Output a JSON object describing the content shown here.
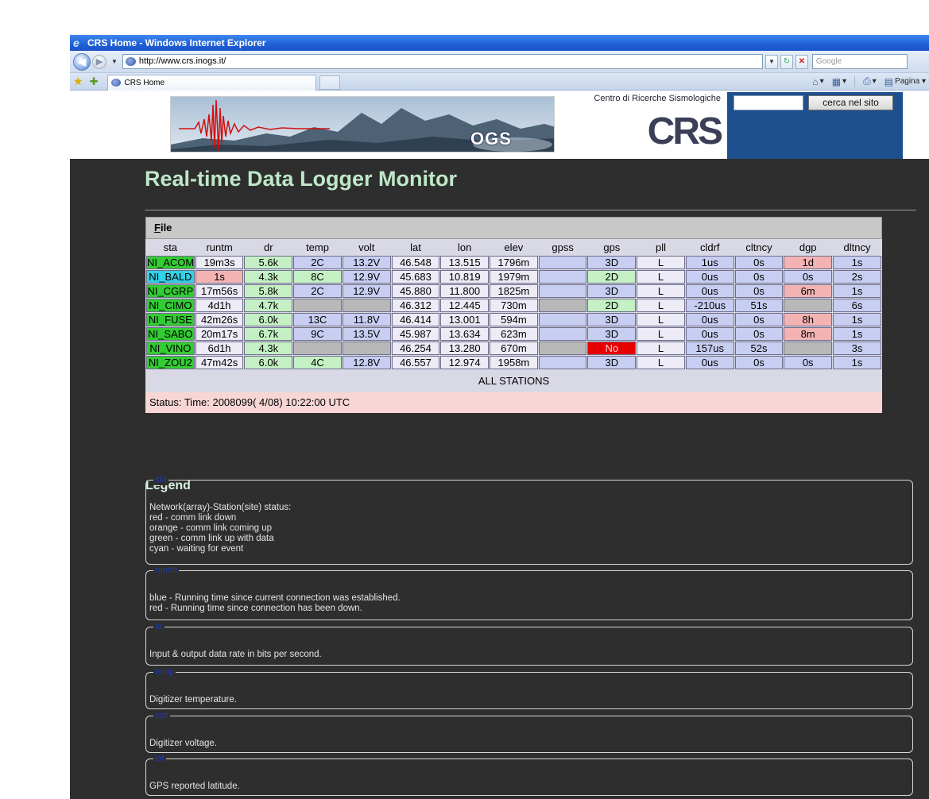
{
  "browser": {
    "title": "CRS Home - Windows Internet Explorer",
    "url": "http://www.crs.inogs.it/",
    "search_placeholder": "Google",
    "tab_label": "CRS Home",
    "page_menu_label": "Pagina"
  },
  "banner": {
    "caption": "Centro di Ricerche Sismologiche",
    "crs_logo": "CRS",
    "ogs_logo": "OGS",
    "search_button": "cerca nel sito"
  },
  "page": {
    "title": "Real-time Data Logger Monitor",
    "file_menu_rest": "ile",
    "file_menu_mnemonic": "F"
  },
  "table": {
    "headers": [
      "sta",
      "runtm",
      "dr",
      "temp",
      "volt",
      "lat",
      "lon",
      "elev",
      "gpss",
      "gps",
      "pll",
      "cldrf",
      "cltncy",
      "dgp",
      "dltncy"
    ],
    "rows": [
      [
        "NI_ACOM",
        "19m3s",
        "5.6k",
        "2C",
        "13.2V",
        "46.548",
        "13.515",
        "1796m",
        "",
        "3D",
        "L",
        "1us",
        "0s",
        "1d",
        "1s"
      ],
      [
        "NI_BALD",
        "1s",
        "4.3k",
        "8C",
        "12.9V",
        "45.683",
        "10.819",
        "1979m",
        "",
        "2D",
        "L",
        "0us",
        "0s",
        "0s",
        "2s"
      ],
      [
        "NI_CGRP",
        "17m56s",
        "5.8k",
        "2C",
        "12.9V",
        "45.880",
        "11.800",
        "1825m",
        "",
        "3D",
        "L",
        "0us",
        "0s",
        "6m",
        "1s"
      ],
      [
        "NI_CIMO",
        "4d1h",
        "4.7k",
        "",
        "",
        "46.312",
        "12.445",
        "730m",
        "",
        "2D",
        "L",
        "-210us",
        "51s",
        "",
        "6s"
      ],
      [
        "NI_FUSE",
        "42m26s",
        "6.0k",
        "13C",
        "11.8V",
        "46.414",
        "13.001",
        "594m",
        "",
        "3D",
        "L",
        "0us",
        "0s",
        "8h",
        "1s"
      ],
      [
        "NI_SABO",
        "20m17s",
        "6.7k",
        "9C",
        "13.5V",
        "45.987",
        "13.634",
        "623m",
        "",
        "3D",
        "L",
        "0us",
        "0s",
        "8m",
        "1s"
      ],
      [
        "NI_VINO",
        "6d1h",
        "4.3k",
        "",
        "",
        "46.254",
        "13.280",
        "670m",
        "",
        "No",
        "L",
        "157us",
        "52s",
        "",
        "3s"
      ],
      [
        "NI_ZOU2",
        "47m42s",
        "6.0k",
        "4C",
        "12.8V",
        "46.557",
        "12.974",
        "1958m",
        "",
        "3D",
        "L",
        "0us",
        "0s",
        "0s",
        "1s"
      ]
    ],
    "cell_colors": [
      [
        "green",
        "white",
        "lgreen",
        "lavender",
        "lavender",
        "white",
        "white",
        "white",
        "lavender",
        "lavender",
        "white",
        "lavender",
        "lavender",
        "pink",
        "lavender"
      ],
      [
        "cyan",
        "pink",
        "lgreen",
        "lgreen",
        "lavender",
        "white",
        "white",
        "white",
        "lavender",
        "lgreen",
        "white",
        "lavender",
        "lavender",
        "lavender",
        "lavender"
      ],
      [
        "green",
        "white",
        "lgreen",
        "lavender",
        "lavender",
        "white",
        "white",
        "white",
        "lavender",
        "lavender",
        "white",
        "lavender",
        "lavender",
        "pink",
        "lavender"
      ],
      [
        "green",
        "white",
        "lgreen",
        "gray",
        "gray",
        "white",
        "white",
        "white",
        "gray",
        "lgreen",
        "white",
        "lavender",
        "lavender",
        "gray",
        "lavender"
      ],
      [
        "green",
        "white",
        "lgreen",
        "lavender",
        "lavender",
        "white",
        "white",
        "white",
        "lavender",
        "lavender",
        "white",
        "lavender",
        "lavender",
        "pink",
        "lavender"
      ],
      [
        "green",
        "white",
        "lgreen",
        "lavender",
        "lavender",
        "white",
        "white",
        "white",
        "lavender",
        "lavender",
        "white",
        "lavender",
        "lavender",
        "pink",
        "lavender"
      ],
      [
        "green",
        "white",
        "lgreen",
        "gray",
        "gray",
        "white",
        "white",
        "white",
        "gray",
        "red",
        "white",
        "lavender",
        "lavender",
        "gray",
        "lavender"
      ],
      [
        "green",
        "white",
        "lgreen",
        "lgreen",
        "lavender",
        "white",
        "white",
        "white",
        "lavender",
        "lavender",
        "white",
        "lavender",
        "lavender",
        "lavender",
        "lavender"
      ]
    ],
    "all_stations": "ALL STATIONS",
    "status": "Status: Time: 2008099( 4/08) 10:22:00 UTC"
  },
  "legend": {
    "title": "Legend",
    "sections": [
      {
        "label": "sta",
        "lines": [
          "Network(array)-Station(site) status:",
          "red - comm link down",
          "orange - comm link coming up",
          "green - comm link up with data",
          "cyan - waiting for event"
        ]
      },
      {
        "label": "runtm",
        "lines": [
          "blue - Running time since current connection was established.",
          "red - Running time since connection has been down."
        ]
      },
      {
        "label": "dr",
        "lines": [
          "Input & output data rate in bits per second."
        ]
      },
      {
        "label": "temp",
        "lines": [
          "Digitizer temperature."
        ]
      },
      {
        "label": "volt",
        "lines": [
          "Digitizer voltage."
        ]
      },
      {
        "label": "lat",
        "lines": [
          "GPS reported latitude."
        ]
      }
    ]
  },
  "colors": {
    "page_background": "#2e2e2e",
    "title_color": "#bfe7c8",
    "status_green": "#33cc33",
    "status_cyan": "#33d0e6",
    "alert_pink": "#f4b3b3",
    "alert_red": "#e60000"
  }
}
